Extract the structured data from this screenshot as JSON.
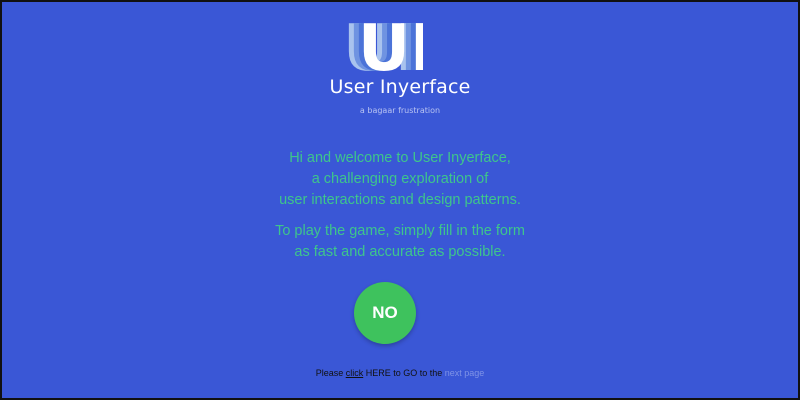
{
  "logo": {
    "text": "UI",
    "colors": {
      "shadow_light": "#a9c3ee",
      "shadow_mid": "#6f93e1",
      "shadow_dark": "#4b73d8",
      "letter": "#ffffff"
    }
  },
  "header": {
    "title": "User Inyerface",
    "subtitle": "a bagaar frustration"
  },
  "intro": {
    "line1": "Hi and welcome to User Inyerface,",
    "line2": "a challenging exploration of",
    "line3": "user interactions and design patterns."
  },
  "instructions": {
    "line1": "To play the game, simply fill in the form",
    "line2": "as fast and accurate as possible."
  },
  "no_button": {
    "label": "NO"
  },
  "footer": {
    "text_before": "Please ",
    "click_link": "click",
    "text_middle": " HERE to GO to the ",
    "next_page_link": "next page"
  },
  "colors": {
    "background": "#3a57d6",
    "accent_green_text": "#3ec58c",
    "button_green": "#3ec25d",
    "muted_link": "#7f93e6"
  }
}
